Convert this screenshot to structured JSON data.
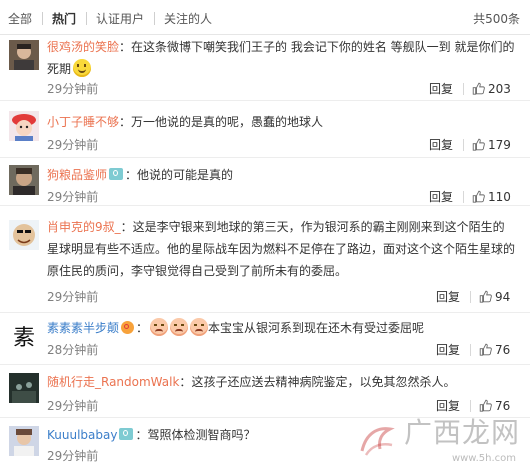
{
  "tabs": {
    "all": "全部",
    "hot": "热门",
    "verified": "认证用户",
    "following": "关注的人",
    "total": "共500条"
  },
  "actions": {
    "reply": "回复"
  },
  "comments": [
    {
      "user": "很鸡汤的笑脸",
      "sep": "：",
      "text": "在这条微博下嘲笑我们王子的 我会记下你的姓名 等舰队一到 就是你们的死期",
      "time": "29分钟前",
      "likes": "203"
    },
    {
      "user": "小丁子睡不够",
      "sep": "：",
      "text": "万一他说的是真的呢，愚蠢的地球人",
      "time": "29分钟前",
      "likes": "179"
    },
    {
      "user": "狗粮品鉴师",
      "sep": "：",
      "text": "他说的可能是真的",
      "time": "29分钟前",
      "likes": "110"
    },
    {
      "user": "肖申克的9叔_",
      "sep": "：",
      "text": "这是李守银来到地球的第三天，作为银河系的霸主刚刚来到这个陌生的星球明显有些不适应。他的星际战车因为燃料不足停在了路边，面对这个这个陌生星球的原住民的质问，李守银觉得自己受到了前所未有的委屈。",
      "time": "29分钟前",
      "likes": "94"
    },
    {
      "user": "素素素半步颠",
      "sep": "：",
      "text": "本宝宝从银河系到现在还木有受过委屈呢",
      "time": "28分钟前",
      "likes": "76"
    },
    {
      "user": "随机行走_RandomWalk",
      "sep": "：",
      "text": "这孩子还应送去精神病院鉴定，以免其忽然杀人。",
      "time": "29分钟前",
      "likes": "76"
    },
    {
      "user": "Kuuulbabay",
      "sep": "：",
      "text": "驾照体检测智商吗？",
      "time": "29分钟前",
      "likes": ""
    }
  ],
  "watermark": {
    "text": "广西龙网",
    "url": "www.5h.com"
  },
  "icons": {
    "verified_badge": "v-badge-icon",
    "weibo_badge": "weibo-badge-icon",
    "like": "thumbs-up-icon"
  },
  "colors": {
    "username": "#eb7350",
    "username_blue": "#3b7ec9",
    "meta": "#808080"
  }
}
